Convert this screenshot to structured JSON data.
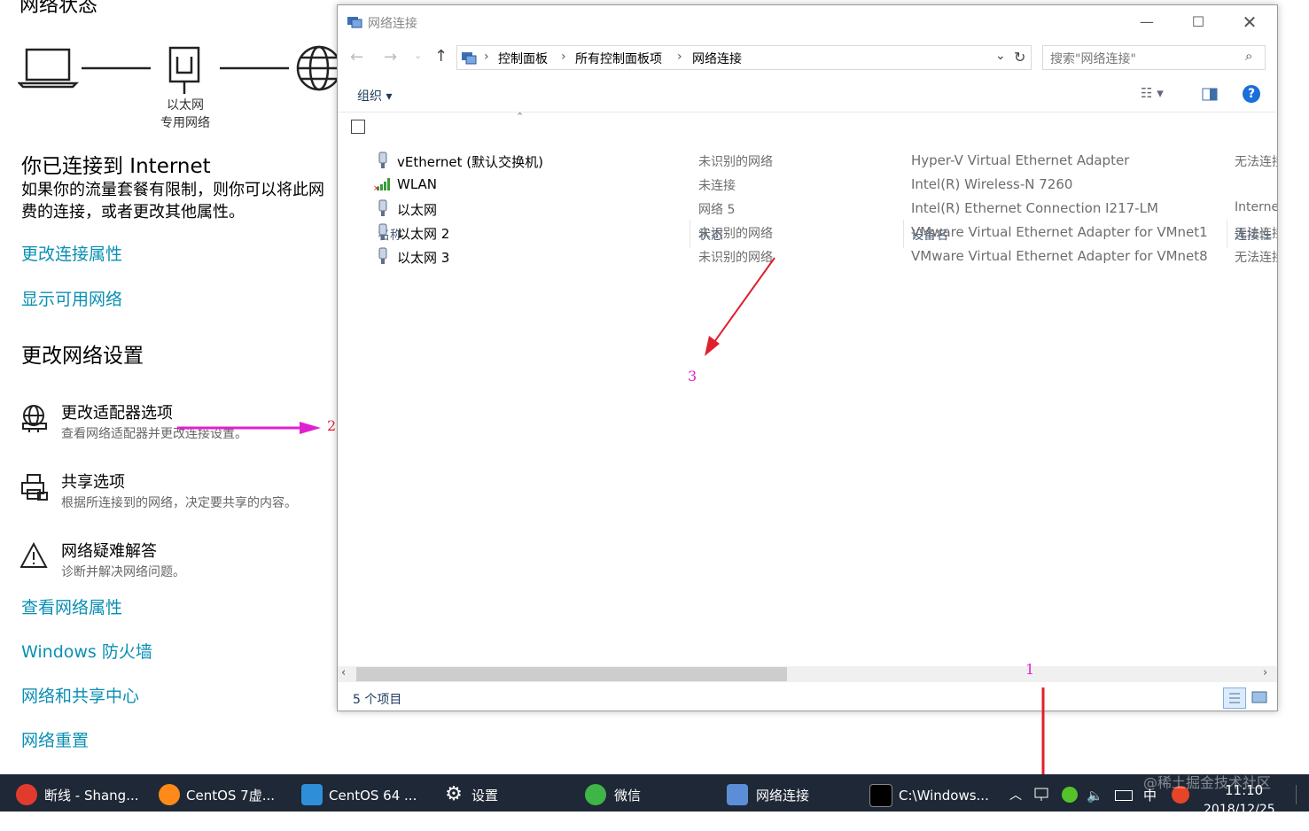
{
  "settings": {
    "partial_heading": "网络状态",
    "adapter_label": "以太网",
    "adapter_sub": "专用网络",
    "connected_title": "你已连接到 Internet",
    "desc_line1": "如果你的流量套餐有限制，则你可以将此网",
    "desc_line2": "费的连接，或者更改其他属性。",
    "link_change_props": "更改连接属性",
    "link_show_networks": "显示可用网络",
    "section_title": "更改网络设置",
    "options": [
      {
        "title": "更改适配器选项",
        "desc": "查看网络适配器并更改连接设置。"
      },
      {
        "title": "共享选项",
        "desc": "根据所连接到的网络，决定要共享的内容。"
      },
      {
        "title": "网络疑难解答",
        "desc": "诊断并解决网络问题。"
      }
    ],
    "links_bottom": [
      "查看网络属性",
      "Windows 防火墙",
      "网络和共享中心",
      "网络重置"
    ]
  },
  "window": {
    "title": "网络连接",
    "breadcrumb": [
      "控制面板",
      "所有控制面板项",
      "网络连接"
    ],
    "search_placeholder": "搜索\"网络连接\"",
    "organize": "组织 ▾",
    "columns": [
      "名称",
      "状态",
      "设备名",
      "连接性"
    ],
    "rows": [
      {
        "name": "vEthernet (默认交换机)",
        "status": "未识别的网络",
        "device": "Hyper-V Virtual Ethernet Adapter",
        "conn": "无法连接"
      },
      {
        "name": "WLAN",
        "status": "未连接",
        "device": "Intel(R) Wireless-N 7260",
        "conn": ""
      },
      {
        "name": "以太网",
        "status": "网络 5",
        "device": "Intel(R) Ethernet Connection I217-LM",
        "conn": "Internet"
      },
      {
        "name": "以太网 2",
        "status": "未识别的网络",
        "device": "VMware Virtual Ethernet Adapter for VMnet1",
        "conn": "无法连接"
      },
      {
        "name": "以太网 3",
        "status": "未识别的网络",
        "device": "VMware Virtual Ethernet Adapter for VMnet8",
        "conn": "无法连接"
      }
    ],
    "status_text": "5 个项目"
  },
  "annotations": [
    "1",
    "2",
    "3"
  ],
  "taskbar": {
    "items": [
      "断线 - Shang...",
      "CentOS 7虚...",
      "CentOS 64 ...",
      "设置",
      "微信",
      "网络连接",
      "C:\\Windows..."
    ],
    "ime": "中",
    "time": "11:10",
    "date": "2018/12/25",
    "watermark": "@稀土掘金技术社区"
  },
  "colors": {
    "link": "#0a8fb3",
    "taskbar": "#1f2836",
    "arrow_red": "#e0202c",
    "arrow_magenta": "#e020d0"
  }
}
